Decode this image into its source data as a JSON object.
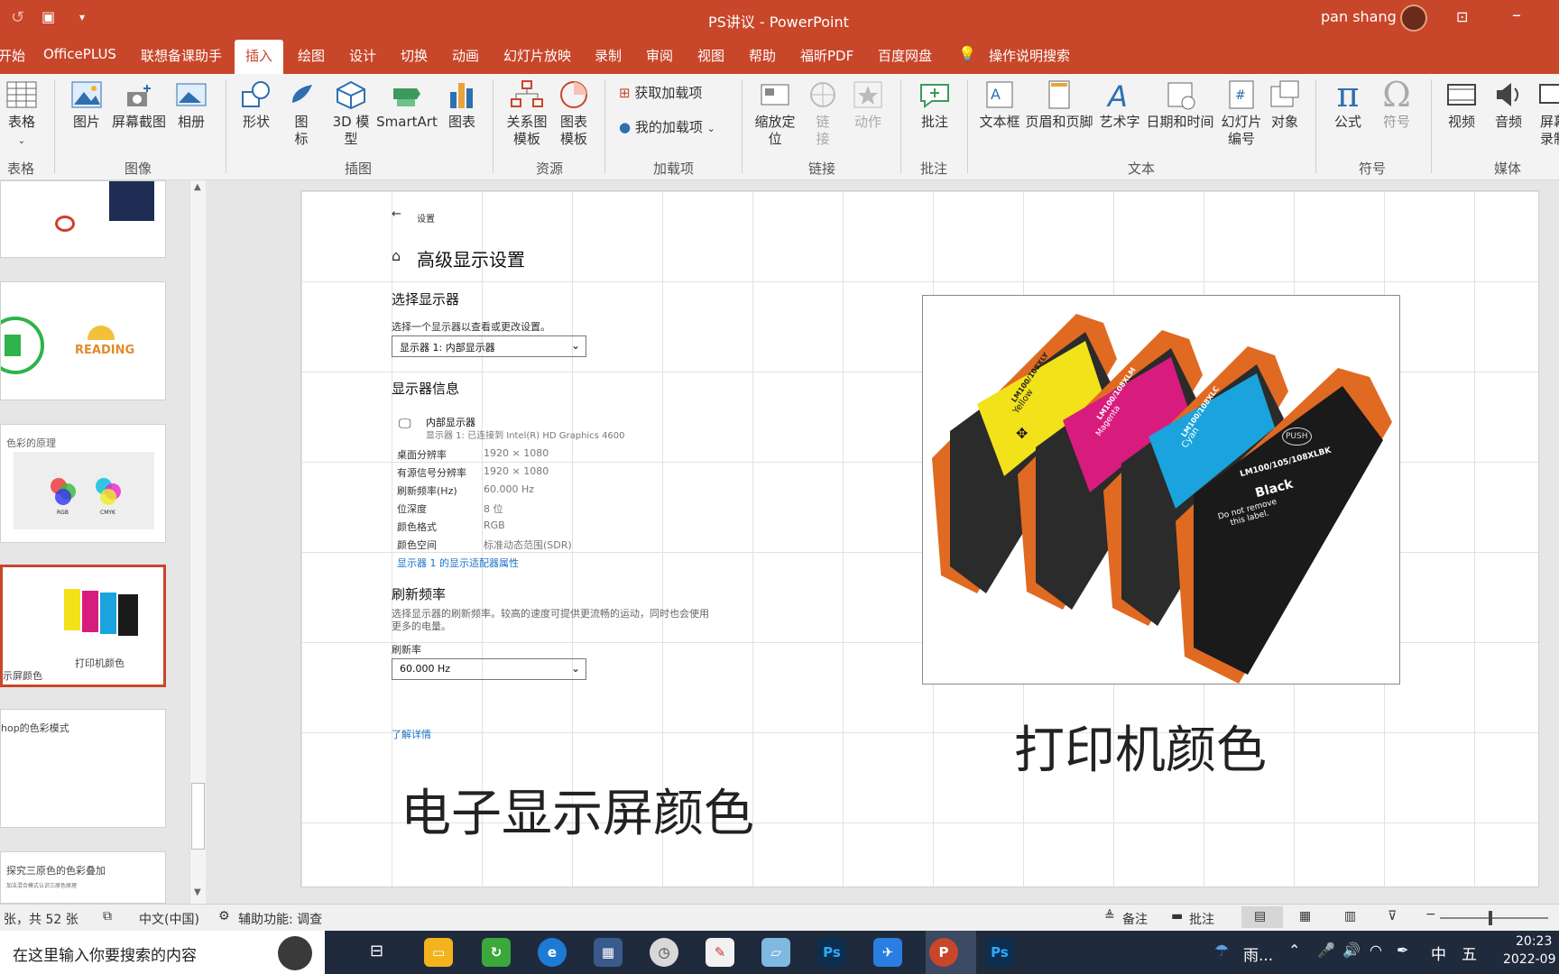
{
  "window": {
    "title": "PS讲议  -  PowerPoint",
    "user": "pan shang"
  },
  "tabs": [
    "开始",
    "OfficePLUS",
    "联想备课助手",
    "插入",
    "绘图",
    "设计",
    "切换",
    "动画",
    "幻灯片放映",
    "录制",
    "审阅",
    "视图",
    "帮助",
    "福昕PDF",
    "百度网盘",
    "操作说明搜索"
  ],
  "ribbon": {
    "table": "表格",
    "picture": "图片",
    "screenshot": "屏幕截图",
    "album": "相册",
    "shapes": "形状",
    "icons_a": "图",
    "icons_b": "标",
    "model_a": "3D 模",
    "model_b": "型",
    "smartart": "SmartArt",
    "chart": "图表",
    "rel_a": "关系图",
    "rel_b": "模板",
    "cht_a": "图表",
    "cht_b": "模板",
    "get_addin": "获取加载项",
    "my_addin": "我的加载项",
    "zoom_a": "缩放定",
    "zoom_b": "位",
    "link_a": "链",
    "link_b": "接",
    "action": "动作",
    "comment": "批注",
    "textbox": "文本框",
    "header": "页眉和页脚",
    "wordart": "艺术字",
    "datetime": "日期和时间",
    "slidenum_a": "幻灯片",
    "slidenum_b": "编号",
    "object": "对象",
    "equation": "公式",
    "symbol": "符号",
    "video": "视频",
    "audio": "音频",
    "rec_a": "屏幕",
    "rec_b": "录制",
    "groups": {
      "table": "表格",
      "image": "图像",
      "illus": "插图",
      "res": "资源",
      "addin": "加载项",
      "link": "链接",
      "comment": "批注",
      "text": "文本",
      "symbol": "符号",
      "media": "媒体"
    }
  },
  "thumbs": {
    "t3_title": "色彩的原理",
    "t3_rgb": "RGB",
    "t3_cmyk": "CMYK",
    "t4_side": "示屏颜色",
    "t4_cap": "打印机颜色",
    "t5_title": "hop的色彩模式",
    "t6_title": "探究三原色的色彩叠加",
    "t6_sub": "加法混合模式认识三原色原理",
    "reading": "READING"
  },
  "slide": {
    "settings": {
      "back": "设置",
      "page_title": "高级显示设置",
      "select_display": "选择显示器",
      "select_hint": "选择一个显示器以查看或更改设置。",
      "display_dropdown": "显示器 1: 内部显示器",
      "info_title": "显示器信息",
      "monitor_name": "内部显示器",
      "monitor_sub": "显示器 1: 已连接到 Intel(R) HD Graphics 4600",
      "rows": [
        {
          "label": "桌面分辨率",
          "value": "1920 × 1080"
        },
        {
          "label": "有源信号分辨率",
          "value": "1920 × 1080"
        },
        {
          "label": "刷新频率(Hz)",
          "value": "60.000 Hz"
        },
        {
          "label": "位深度",
          "value": "8 位"
        },
        {
          "label": "颜色格式",
          "value": "RGB"
        },
        {
          "label": "颜色空间",
          "value": "标准动态范围(SDR)"
        }
      ],
      "adapter_link": "显示器 1 的显示适配器属性",
      "refresh_title": "刷新频率",
      "refresh_desc1": "选择显示器的刷新频率。较高的速度可提供更流畅的运动，同时也会使用",
      "refresh_desc2": "更多的电量。",
      "refresh_label": "刷新率",
      "refresh_dropdown": "60.000 Hz",
      "learn_more": "了解详情"
    },
    "cartridges": [
      {
        "label": "LM100/108XLY",
        "name": "Yellow",
        "color": "#f2e21a"
      },
      {
        "label": "LM100/108XLM",
        "name": "Magenta",
        "color": "#d81c7e"
      },
      {
        "label": "LM100/108XLC",
        "name": "Cyan",
        "color": "#1aa3dc"
      },
      {
        "label": "LM100/105/108XLBK",
        "name": "Black",
        "color": "#1a1a1a"
      }
    ],
    "push": "PUSH",
    "do_not": "Do not remove this label.",
    "caption_printer": "打印机颜色",
    "caption_screen": "电子显示屏颜色"
  },
  "status": {
    "slide": "张，共 52 张",
    "lang": "中文(中国)",
    "access": "辅助功能: 调查",
    "notes": "备注",
    "comments": "批注"
  },
  "taskbar": {
    "search": "在这里输入你要搜索的内容",
    "weather": "雨...",
    "ime1": "中",
    "ime2": "五",
    "time": "20:23",
    "date": "2022-09"
  }
}
